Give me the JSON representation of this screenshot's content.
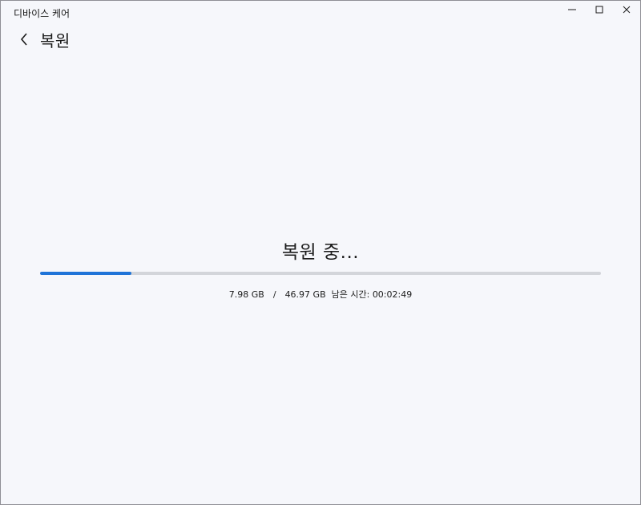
{
  "window": {
    "title": "디바이스 케어",
    "controls": [
      "minimize-icon",
      "maximize-icon",
      "close-icon"
    ]
  },
  "header": {
    "back_icon": "chevron-left-icon",
    "title": "복원"
  },
  "main": {
    "heading": "복원 중...",
    "progress": {
      "fraction": 0.163,
      "fill_color": "#1f74d8",
      "track_color": "#d3d5da",
      "transferred": "7.98 GB",
      "separator": "/",
      "total": "46.97 GB",
      "remaining_label": "남은 시간:",
      "remaining_time": "00:02:49"
    }
  }
}
